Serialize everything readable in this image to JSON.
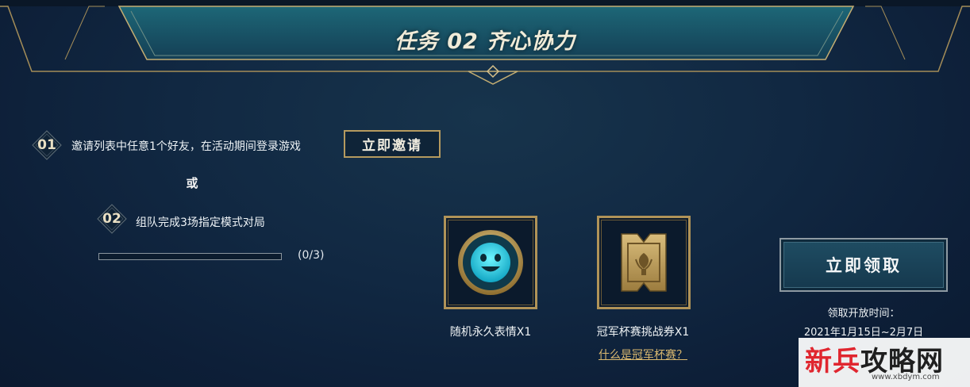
{
  "header": {
    "title": "任务 02  齐心协力"
  },
  "task1": {
    "number": "01",
    "text": "邀请列表中任意1个好友，在活动期间登录游戏",
    "invite_button": "立即邀请"
  },
  "divider": {
    "or_text": "或"
  },
  "task2": {
    "number": "02",
    "text": "组队完成3场指定模式对局",
    "progress_label": "(0/3)",
    "progress_fraction": 0
  },
  "rewards": [
    {
      "icon": "smiley-emote-icon",
      "label": "随机永久表情X1"
    },
    {
      "icon": "champion-cup-ticket-icon",
      "label": "冠军杯赛挑战券X1",
      "link": "什么是冠军杯赛？"
    }
  ],
  "claim": {
    "button": "立即领取",
    "time_label": "领取开放时间：",
    "time_range": "2021年1月15日~2月7日"
  },
  "watermark": {
    "text_red": "新兵",
    "text_dark": "攻略网",
    "url": "www.xbdym.com"
  },
  "colors": {
    "gold": "#c9a96a",
    "teal_frame": "#2f8fa0",
    "claim_button": "#1f4d63",
    "background": "#112842"
  }
}
